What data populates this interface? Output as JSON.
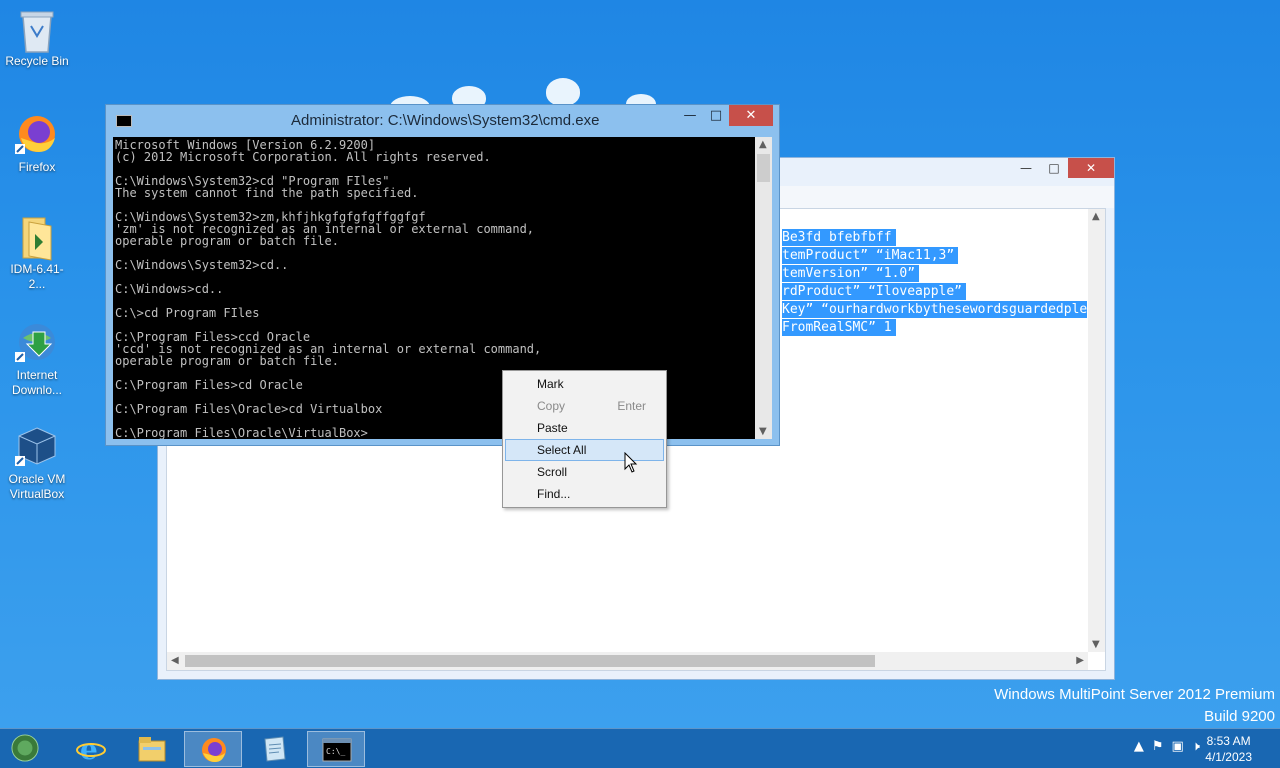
{
  "desktop": {
    "icons": [
      {
        "label": "Recycle Bin"
      },
      {
        "label": "Firefox"
      },
      {
        "label": "IDM-6.41-2..."
      },
      {
        "label": "Internet",
        "label2": "Downlo..."
      },
      {
        "label": "Oracle VM",
        "label2": "VirtualBox"
      }
    ],
    "watermark": {
      "line1": "Windows MultiPoint Server 2012 Premium",
      "line2": "Build 9200"
    }
  },
  "back_window": {
    "selected_lines": [
      "Be3fd bfebfbff",
      "temProduct” “iMac11,3”",
      "temVersion” “1.0”",
      "rdProduct” “Iloveapple”",
      "Key” “ourhardworkbythesewordsguardedple",
      "FromRealSMC” 1"
    ]
  },
  "cmd_window": {
    "title": "Administrator: C:\\Windows\\System32\\cmd.exe",
    "console_lines": [
      "Microsoft Windows [Version 6.2.9200]",
      "(c) 2012 Microsoft Corporation. All rights reserved.",
      "",
      "C:\\Windows\\System32>cd \"Program FIles\"",
      "The system cannot find the path specified.",
      "",
      "C:\\Windows\\System32>zm,khfjhkgfgfgfgffggfgf",
      "'zm' is not recognized as an internal or external command,",
      "operable program or batch file.",
      "",
      "C:\\Windows\\System32>cd..",
      "",
      "C:\\Windows>cd..",
      "",
      "C:\\>cd Program FIles",
      "",
      "C:\\Program Files>ccd Oracle",
      "'ccd' is not recognized as an internal or external command,",
      "operable program or batch file.",
      "",
      "C:\\Program Files>cd Oracle",
      "",
      "C:\\Program Files\\Oracle>cd Virtualbox",
      "",
      "C:\\Program Files\\Oracle\\VirtualBox>"
    ]
  },
  "context_menu": {
    "items": [
      {
        "label": "Mark",
        "shortcut": ""
      },
      {
        "label": "Copy",
        "shortcut": "Enter"
      },
      {
        "label": "Paste",
        "shortcut": ""
      },
      {
        "label": "Select All",
        "shortcut": ""
      },
      {
        "label": "Scroll",
        "shortcut": ""
      },
      {
        "label": "Find...",
        "shortcut": ""
      }
    ]
  },
  "taskbar": {
    "clock_time": "8:53 AM",
    "clock_date": "4/1/2023"
  },
  "colors": {
    "desktop": "#2a93ea",
    "selection": "#3399ff",
    "close_button": "#c7504a"
  }
}
